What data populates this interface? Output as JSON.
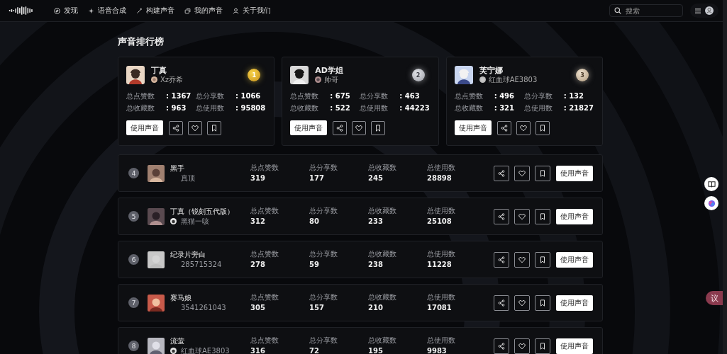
{
  "nav": {
    "items": [
      {
        "label": "发现"
      },
      {
        "label": "语音合成"
      },
      {
        "label": "构建声音"
      },
      {
        "label": "我的声音"
      },
      {
        "label": "关于我们"
      }
    ],
    "search": {
      "placeholder": "搜索"
    }
  },
  "title": "声音排行榜",
  "top": [
    {
      "rank": "1",
      "name": "丁真",
      "uploader": "Xz乔希",
      "stats": [
        {
          "label": "总点赞数",
          "value": ": 1367"
        },
        {
          "label": "总分享数",
          "value": ": 1066"
        },
        {
          "label": "总收藏数",
          "value": ": 963"
        },
        {
          "label": "总使用数",
          "value": ": 95808"
        }
      ],
      "use_button": "使用声音"
    },
    {
      "rank": "2",
      "name": "AD学姐",
      "uploader": "帅哥",
      "stats": [
        {
          "label": "总点赞数",
          "value": ": 675"
        },
        {
          "label": "总分享数",
          "value": ": 463"
        },
        {
          "label": "总收藏数",
          "value": ": 522"
        },
        {
          "label": "总使用数",
          "value": ": 44223"
        }
      ],
      "use_button": "使用声音"
    },
    {
      "rank": "3",
      "name": "芙宁娜",
      "uploader": "红血球AE3803",
      "stats": [
        {
          "label": "总点赞数",
          "value": ": 496"
        },
        {
          "label": "总分享数",
          "value": ": 132"
        },
        {
          "label": "总收藏数",
          "value": ": 321"
        },
        {
          "label": "总使用数",
          "value": ": 21827"
        }
      ],
      "use_button": "使用声音"
    }
  ],
  "rows": [
    {
      "rank": "4",
      "name": "黑手",
      "uploader": "真顶",
      "uploader_avatar": false,
      "stats": [
        {
          "label": "总点赞数",
          "value": "319"
        },
        {
          "label": "总分享数",
          "value": "177"
        },
        {
          "label": "总收藏数",
          "value": "245"
        },
        {
          "label": "总使用数",
          "value": "28898"
        }
      ],
      "use_button": "使用声音"
    },
    {
      "rank": "5",
      "name": "丁真（锐刻五代版）",
      "uploader": "黑猫一咳",
      "uploader_avatar": true,
      "stats": [
        {
          "label": "总点赞数",
          "value": "312"
        },
        {
          "label": "总分享数",
          "value": "80"
        },
        {
          "label": "总收藏数",
          "value": "233"
        },
        {
          "label": "总使用数",
          "value": "25108"
        }
      ],
      "use_button": "使用声音"
    },
    {
      "rank": "6",
      "name": "纪录片旁白",
      "uploader": "285715324",
      "uploader_avatar": false,
      "stats": [
        {
          "label": "总点赞数",
          "value": "278"
        },
        {
          "label": "总分享数",
          "value": "59"
        },
        {
          "label": "总收藏数",
          "value": "238"
        },
        {
          "label": "总使用数",
          "value": "11228"
        }
      ],
      "use_button": "使用声音"
    },
    {
      "rank": "7",
      "name": "赛马娘",
      "uploader": "3541261043",
      "uploader_avatar": false,
      "stats": [
        {
          "label": "总点赞数",
          "value": "305"
        },
        {
          "label": "总分享数",
          "value": "157"
        },
        {
          "label": "总收藏数",
          "value": "210"
        },
        {
          "label": "总使用数",
          "value": "17081"
        }
      ],
      "use_button": "使用声音"
    },
    {
      "rank": "8",
      "name": "流萤",
      "uploader": "红血球AE3803",
      "uploader_avatar": true,
      "stats": [
        {
          "label": "总点赞数",
          "value": "316"
        },
        {
          "label": "总分享数",
          "value": "72"
        },
        {
          "label": "总收藏数",
          "value": "195"
        },
        {
          "label": "总使用数",
          "value": "9983"
        }
      ],
      "use_button": "使用声音"
    }
  ],
  "side_tag": "议"
}
